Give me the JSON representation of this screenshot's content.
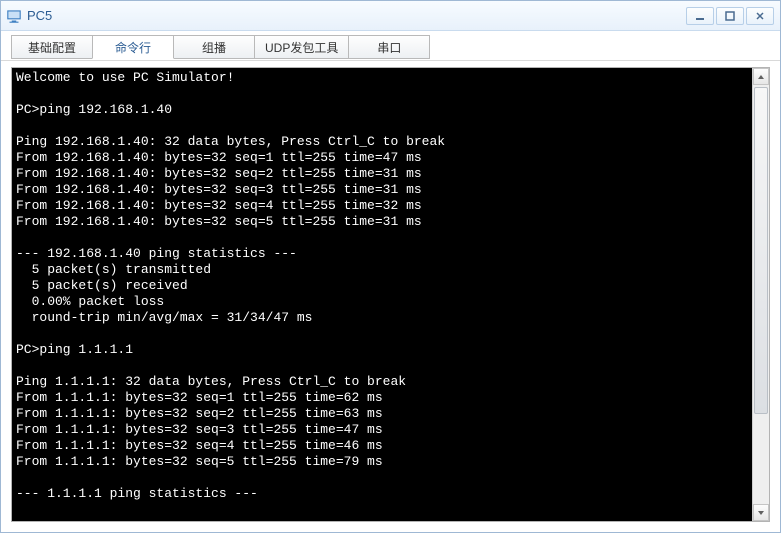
{
  "window": {
    "title": "PC5"
  },
  "tabs": [
    {
      "label": "基础配置"
    },
    {
      "label": "命令行"
    },
    {
      "label": "组播"
    },
    {
      "label": "UDP发包工具"
    },
    {
      "label": "串口"
    }
  ],
  "terminal_lines": [
    "Welcome to use PC Simulator!",
    "",
    "PC>ping 192.168.1.40",
    "",
    "Ping 192.168.1.40: 32 data bytes, Press Ctrl_C to break",
    "From 192.168.1.40: bytes=32 seq=1 ttl=255 time=47 ms",
    "From 192.168.1.40: bytes=32 seq=2 ttl=255 time=31 ms",
    "From 192.168.1.40: bytes=32 seq=3 ttl=255 time=31 ms",
    "From 192.168.1.40: bytes=32 seq=4 ttl=255 time=32 ms",
    "From 192.168.1.40: bytes=32 seq=5 ttl=255 time=31 ms",
    "",
    "--- 192.168.1.40 ping statistics ---",
    "  5 packet(s) transmitted",
    "  5 packet(s) received",
    "  0.00% packet loss",
    "  round-trip min/avg/max = 31/34/47 ms",
    "",
    "PC>ping 1.1.1.1",
    "",
    "Ping 1.1.1.1: 32 data bytes, Press Ctrl_C to break",
    "From 1.1.1.1: bytes=32 seq=1 ttl=255 time=62 ms",
    "From 1.1.1.1: bytes=32 seq=2 ttl=255 time=63 ms",
    "From 1.1.1.1: bytes=32 seq=3 ttl=255 time=47 ms",
    "From 1.1.1.1: bytes=32 seq=4 ttl=255 time=46 ms",
    "From 1.1.1.1: bytes=32 seq=5 ttl=255 time=79 ms",
    "",
    "--- 1.1.1.1 ping statistics ---"
  ]
}
